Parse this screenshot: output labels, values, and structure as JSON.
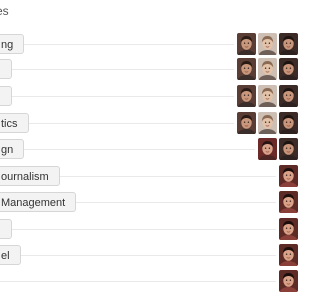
{
  "header": {
    "title_fragment": "es"
  },
  "topics": [
    {
      "label": "ng",
      "avatars": [
        "person-a",
        "person-b",
        "person-c",
        "person-d"
      ]
    },
    {
      "label": "",
      "avatars": [
        "person-a",
        "person-b",
        "person-c",
        "person-d"
      ]
    },
    {
      "label": "",
      "avatars": [
        "person-a",
        "person-b",
        "person-c",
        "person-d"
      ]
    },
    {
      "label": "tics",
      "avatars": [
        "person-a",
        "person-b",
        "person-c",
        "person-d"
      ]
    },
    {
      "label": "gn",
      "avatars": [
        "person-e",
        "person-c",
        "person-d"
      ]
    },
    {
      "label": "ournalism",
      "avatars": [
        "person-f"
      ]
    },
    {
      "label": "Management",
      "avatars": [
        "person-f"
      ]
    },
    {
      "label": "",
      "avatars": [
        "person-f"
      ]
    },
    {
      "label": "el",
      "avatars": [
        "person-f"
      ]
    },
    {
      "label": "",
      "avatars": [
        "person-f"
      ]
    }
  ]
}
